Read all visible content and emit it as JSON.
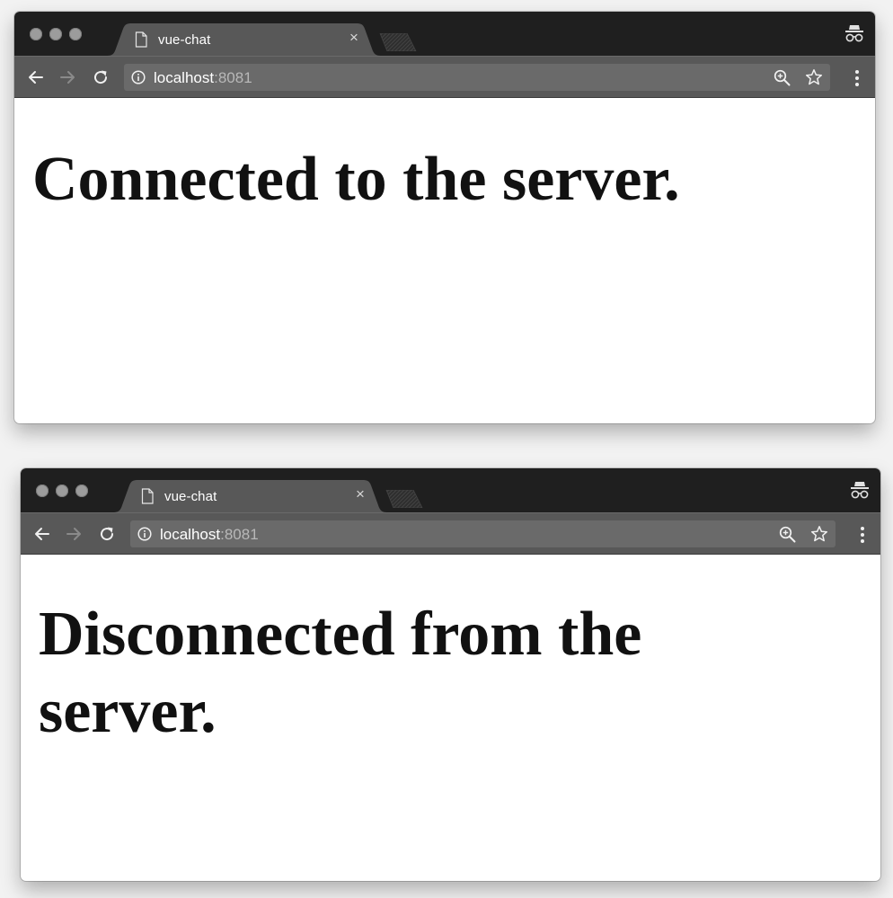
{
  "windows": [
    {
      "tab": {
        "title": "vue-chat",
        "close_glyph": "×"
      },
      "address_bar": {
        "host": "localhost",
        "port": ":8081"
      },
      "page": {
        "heading": "Connected to the server."
      }
    },
    {
      "tab": {
        "title": "vue-chat",
        "close_glyph": "×"
      },
      "address_bar": {
        "host": "localhost",
        "port": ":8081"
      },
      "page": {
        "heading": "Disconnected from the server."
      }
    }
  ],
  "icons": {
    "window_controls": [
      "close-dot",
      "minimize-dot",
      "maximize-dot"
    ],
    "tab": "page-icon",
    "incognito": "incognito-icon",
    "toolbar": [
      "back-arrow-icon",
      "forward-arrow-icon",
      "reload-icon",
      "info-icon",
      "zoom-icon",
      "star-icon",
      "kebab-menu-icon"
    ]
  },
  "colors": {
    "titlebar": "#1f1f1f",
    "tab": "#585858",
    "toolbar": "#585858",
    "omnibox": "#6a6a6a",
    "heading_text": "#111111"
  }
}
